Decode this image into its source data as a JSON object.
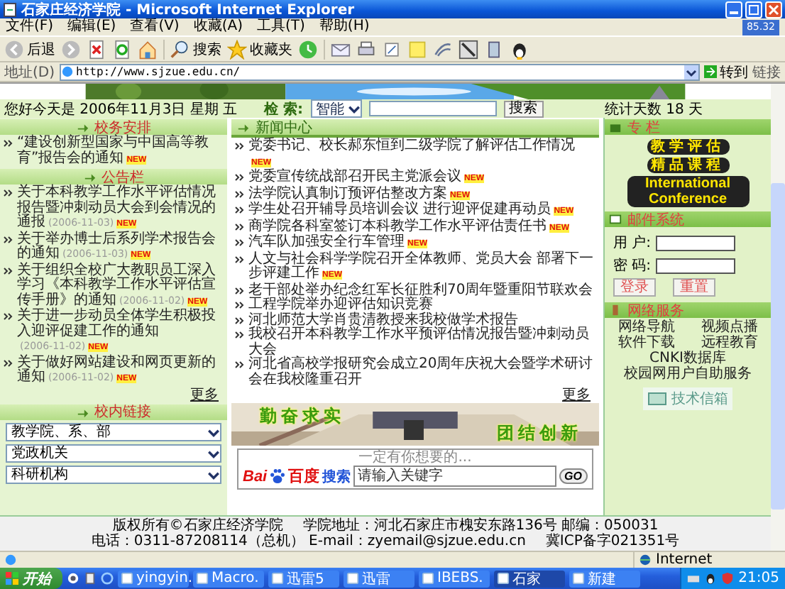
{
  "window": {
    "title": "石家庄经济学院 - Microsoft Internet Explorer"
  },
  "widget": "85.32",
  "menu": [
    "文件(F)",
    "编辑(E)",
    "查看(V)",
    "收藏(A)",
    "工具(T)",
    "帮助(H)"
  ],
  "toolbar": {
    "back": "后退",
    "search": "搜索",
    "favorites": "收藏夹"
  },
  "address": {
    "label": "地址(D)",
    "url": "http://www.sjzue.edu.cn/",
    "go": "转到",
    "links": "链接"
  },
  "page": {
    "greeting": "您好今天是 2006年11月3日 星期 五",
    "search": {
      "label": "检 索:",
      "scope": "智能",
      "button": "搜索"
    },
    "visit_days": "统计天数 18 天",
    "left": {
      "sections": [
        {
          "title": "校务安排",
          "items": [
            {
              "text": "“建设创新型国家与中国高等教育”报告会的通知",
              "badge": "NEW"
            }
          ]
        },
        {
          "title": "公告栏",
          "more": "更多",
          "items": [
            {
              "text": "关于本科教学工作水平评估情况报告暨冲刺动员大会到会情况的通报",
              "date": "(2006-11-03)",
              "badge": "NEW"
            },
            {
              "text": "关于举办博士后系列学术报告会的通知",
              "date": "(2006-11-03)",
              "badge": "NEW"
            },
            {
              "text": "关于组织全校广大教职员工深入学习《本科教学工作水平评估宣传手册》的通知",
              "date": "(2006-11-02)",
              "badge": "NEW"
            },
            {
              "text": "关于进一步动员全体学生积极投入迎评促建工作的通知",
              "date": "(2006-11-02)",
              "badge": "NEW"
            },
            {
              "text": "关于做好网站建设和网页更新的通知",
              "date": "(2006-11-02)",
              "badge": "NEW"
            }
          ]
        }
      ],
      "links_title": "校内链接",
      "selects": [
        "教学院、系、部",
        "党政机关",
        "科研机构"
      ]
    },
    "news": {
      "title": "新闻中心",
      "more": "更多",
      "items": [
        {
          "text": "党委书记、校长郝东恒到二级学院了解评估工作情况",
          "badge": "NEW"
        },
        {
          "text": "党委宣传统战部召开民主党派会议",
          "badge": "NEW"
        },
        {
          "text": "法学院认真制订预评估整改方案",
          "badge": "NEW"
        },
        {
          "text": "学生处召开辅导员培训会议 进行迎评促建再动员",
          "badge": "NEW"
        },
        {
          "text": "商学院各科室签订本科教学工作水平评估责任书",
          "badge": "NEW"
        },
        {
          "text": "汽车队加强安全行车管理",
          "badge": "NEW"
        },
        {
          "text": "人文与社会科学学院召开全体教师、党员大会 部署下一步评建工作",
          "badge": "NEW"
        },
        {
          "text": "老干部处举办纪念红军长征胜利70周年暨重阳节联欢会"
        },
        {
          "text": "工程学院举办迎评估知识竞赛"
        },
        {
          "text": "河北师范大学肖贵清教授来我校做学术报告"
        },
        {
          "text": "我校召开本科教学工作水平预评估情况报告暨冲刺动员大会"
        },
        {
          "text": "河北省高校学报研究会成立20周年庆祝大会暨学术研讨会在我校隆重召开"
        }
      ]
    },
    "banner": {
      "slogan_1": "勤奋求实",
      "slogan_2": "团结创新"
    },
    "baidu": {
      "hint": "一定有你想要的...",
      "logo_1": "Bai",
      "logo_2": "百度",
      "label": "搜索",
      "placeholder": "请输入关键字",
      "button": "GO"
    },
    "right": {
      "column_title": "专 栏",
      "features": [
        "教学评估",
        "精品课程",
        "International Conference"
      ],
      "mail": {
        "title": "邮件系统",
        "user_label": "用 户:",
        "password_label": "密 码:",
        "login": "登录",
        "reset": "重置"
      },
      "services": {
        "title": "网络服务",
        "items": [
          "网络导航",
          "视频点播",
          "软件下载",
          "远程教育",
          "CNKI数据库",
          "校园网用户自助服务"
        ]
      },
      "logo": "技术信箱"
    },
    "footer": [
      "版权所有©石家庄经济学院",
      "学院地址：河北石家庄市槐安东路136号 邮编：050031",
      "电话：0311-87208114（总机） E-mail：zyemail@sjzue.edu.cn",
      "冀ICP备字021351号"
    ]
  },
  "status": {
    "zone": "Internet"
  },
  "taskbar": {
    "start": "开始",
    "clock": "21:05",
    "tasks": [
      {
        "label": "yingyin.",
        "selected": false
      },
      {
        "label": "Macro.",
        "selected": false
      },
      {
        "label": "迅雷5",
        "selected": false
      },
      {
        "label": "迅雷",
        "selected": false
      },
      {
        "label": "IBEBS.",
        "selected": false
      },
      {
        "label": "石家",
        "selected": true
      },
      {
        "label": "新建",
        "selected": false
      }
    ]
  }
}
